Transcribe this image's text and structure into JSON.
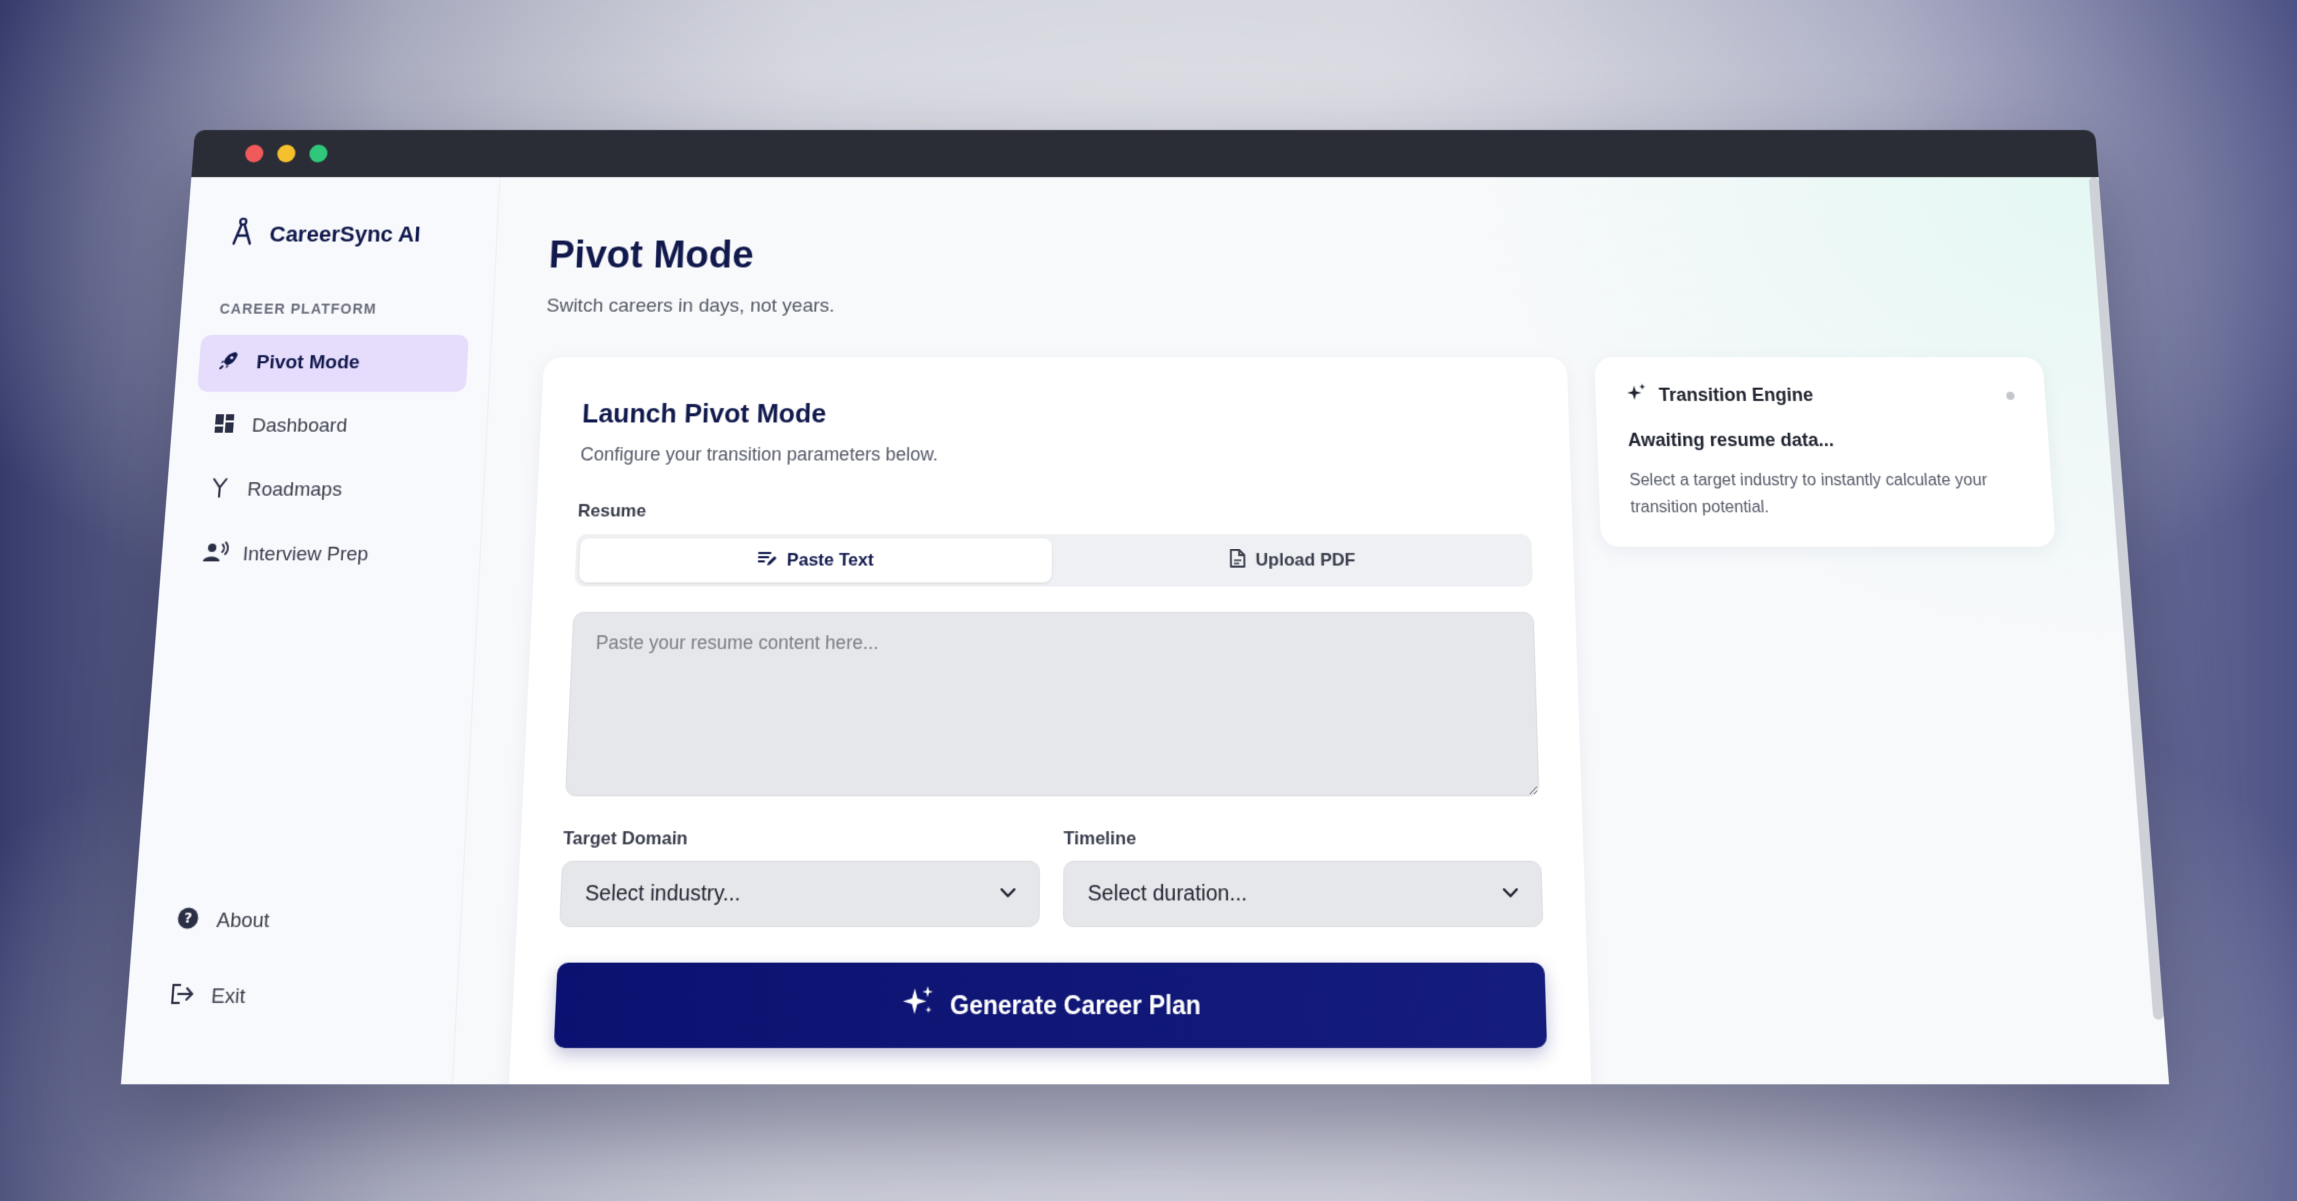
{
  "window": {
    "controls": {
      "close": "#f05a5a",
      "minimize": "#f5c02e",
      "maximize": "#2fc77a"
    }
  },
  "sidebar": {
    "brand": {
      "name": "CareerSync AI",
      "icon": "compass-icon"
    },
    "section_label": "CAREER PLATFORM",
    "items": [
      {
        "label": "Pivot Mode",
        "icon": "rocket-icon",
        "active": true
      },
      {
        "label": "Dashboard",
        "icon": "dashboard-icon",
        "active": false
      },
      {
        "label": "Roadmaps",
        "icon": "fork-icon",
        "active": false
      },
      {
        "label": "Interview Prep",
        "icon": "user-voice-icon",
        "active": false
      }
    ],
    "bottom_items": [
      {
        "label": "About",
        "icon": "help-circle-icon"
      },
      {
        "label": "Exit",
        "icon": "logout-icon"
      }
    ]
  },
  "main": {
    "title": "Pivot Mode",
    "subtitle": "Switch careers in days, not years.",
    "form": {
      "title": "Launch Pivot Mode",
      "subtitle": "Configure your transition parameters below.",
      "resume_label": "Resume",
      "tabs": [
        {
          "label": "Paste Text",
          "icon": "text-lines-icon",
          "active": true
        },
        {
          "label": "Upload PDF",
          "icon": "file-icon",
          "active": false
        }
      ],
      "resume_placeholder": "Paste your resume content here...",
      "target_domain": {
        "label": "Target Domain",
        "value": "Select industry..."
      },
      "timeline": {
        "label": "Timeline",
        "value": "Select duration..."
      },
      "submit_label": "Generate Career Plan"
    },
    "engine": {
      "title": "Transition Engine",
      "status": "Awaiting resume data...",
      "description": "Select a target industry to instantly calculate your transition potential."
    }
  },
  "colors": {
    "brand": "#121a4d",
    "accent_active": "#e6dcfc",
    "cta": "#0b1170"
  }
}
